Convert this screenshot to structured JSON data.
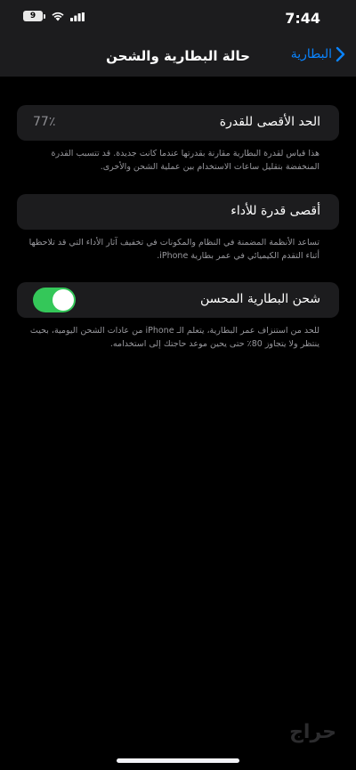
{
  "status_bar": {
    "battery_level": "9",
    "time": "7:44"
  },
  "nav": {
    "title": "حالة البطارية والشحن",
    "back_label": "البطارية"
  },
  "maximum_capacity": {
    "label": "الحد الأقصى للقدرة",
    "value": "77٪",
    "footnote": "هذا قياس لقدرة البطارية مقارنة بقدرتها عندما كانت جديدة. قد تتسبب القدرة المنخفضة بتقليل ساعات الاستخدام بين عملية الشحن والأخرى."
  },
  "peak_performance": {
    "label": "أقصى قدرة للأداء",
    "footnote": "تساعد الأنظمة المضمنة في النظام والمكونات في تخفيف آثار الأداء التي قد تلاحظها أثناء التقدم الكيميائي في عمر بطارية iPhone."
  },
  "optimized_charging": {
    "label": "شحن البطارية المحسن",
    "enabled": true,
    "footnote": "للحد من استنزاف عمر البطارية، يتعلم الـ iPhone من عادات الشحن اليومية، بحيث ينتظر ولا يتجاوز 80٪ حتى يحين موعد حاجتك إلى استخدامه."
  },
  "watermark": "حراج",
  "colors": {
    "accent": "#0a84ff",
    "toggle_on": "#34c759",
    "card_bg": "#1c1c1e"
  }
}
